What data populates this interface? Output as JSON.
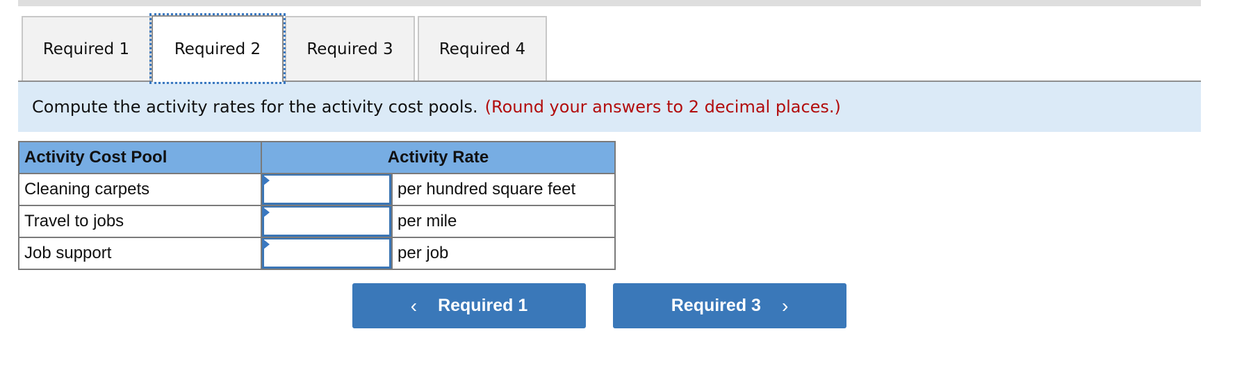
{
  "tabs": [
    {
      "label": "Required 1",
      "active": false
    },
    {
      "label": "Required 2",
      "active": true
    },
    {
      "label": "Required 3",
      "active": false
    },
    {
      "label": "Required 4",
      "active": false
    }
  ],
  "instruction": {
    "text": "Compute the activity rates for the activity cost pools.",
    "hint": "(Round your answers to 2 decimal places.)"
  },
  "table": {
    "headers": [
      "Activity Cost Pool",
      "Activity Rate"
    ],
    "rows": [
      {
        "pool": "Cleaning carpets",
        "value": "",
        "unit": "per hundred square feet"
      },
      {
        "pool": "Travel to jobs",
        "value": "",
        "unit": "per mile"
      },
      {
        "pool": "Job support",
        "value": "",
        "unit": "per job"
      }
    ]
  },
  "navigation": {
    "prev": {
      "label": "Required 1",
      "icon": "chevron-left-icon",
      "glyph": "‹"
    },
    "next": {
      "label": "Required 3",
      "icon": "chevron-right-icon",
      "glyph": "›"
    }
  },
  "colors": {
    "banner_bg": "#dbeaf7",
    "hint_text": "#b20d0d",
    "table_header": "#77ade3",
    "button_bg": "#3a78b9"
  }
}
